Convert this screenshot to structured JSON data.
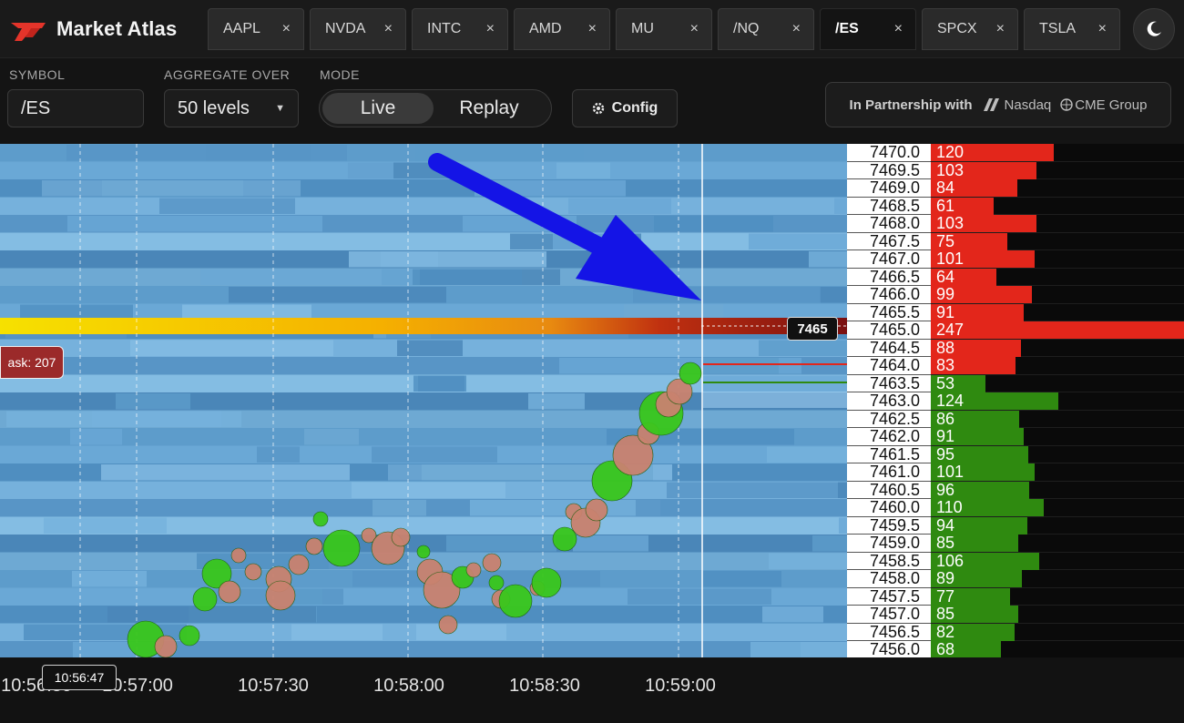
{
  "app": {
    "name": "Market Atlas"
  },
  "tabs": [
    {
      "label": "AAPL",
      "active": false
    },
    {
      "label": "NVDA",
      "active": false
    },
    {
      "label": "INTC",
      "active": false
    },
    {
      "label": "AMD",
      "active": false
    },
    {
      "label": "MU",
      "active": false
    },
    {
      "label": "/NQ",
      "active": false
    },
    {
      "label": "/ES",
      "active": true
    },
    {
      "label": "SPCX",
      "active": false
    },
    {
      "label": "TSLA",
      "active": false
    }
  ],
  "tab_close_glyph": "×",
  "controls": {
    "symbol_label": "SYMBOL",
    "symbol_value": "/ES",
    "aggregate_label": "AGGREGATE OVER",
    "aggregate_value": "50 levels",
    "mode_label": "MODE",
    "mode_options": [
      "Live",
      "Replay"
    ],
    "mode_selected": "Live",
    "config_label": "Config",
    "partner_prefix": "In Partnership with",
    "partner_nasdaq": "Nasdaq",
    "partner_cme": "CME Group"
  },
  "icons": {
    "theme": "moon-icon",
    "config": "gear-icon",
    "logo": "market-atlas-logo"
  },
  "colors": {
    "ask": "#e3261b",
    "bid": "#2f8a10",
    "heat_low": "#5f9fcf",
    "heat_high": "#fff200",
    "annotation_arrow": "#1414e6"
  },
  "chart": {
    "price_marker": "7465",
    "ask_label": "ask: 207",
    "cursor_time": "10:56:47",
    "time_ticks": [
      "10:56:30",
      "10:57:00",
      "10:57:30",
      "10:58:00",
      "10:58:30",
      "10:59:00"
    ]
  },
  "ladder": {
    "max_size": 247,
    "asks": [
      {
        "price": "7470.0",
        "size": 120
      },
      {
        "price": "7469.5",
        "size": 103
      },
      {
        "price": "7469.0",
        "size": 84
      },
      {
        "price": "7468.5",
        "size": 61
      },
      {
        "price": "7468.0",
        "size": 103
      },
      {
        "price": "7467.5",
        "size": 75
      },
      {
        "price": "7467.0",
        "size": 101
      },
      {
        "price": "7466.5",
        "size": 64
      },
      {
        "price": "7466.0",
        "size": 99
      },
      {
        "price": "7465.5",
        "size": 91
      },
      {
        "price": "7465.0",
        "size": 247
      },
      {
        "price": "7464.5",
        "size": 88
      },
      {
        "price": "7464.0",
        "size": 83
      }
    ],
    "bids": [
      {
        "price": "7463.5",
        "size": 53
      },
      {
        "price": "7463.0",
        "size": 124
      },
      {
        "price": "7462.5",
        "size": 86
      },
      {
        "price": "7462.0",
        "size": 91
      },
      {
        "price": "7461.5",
        "size": 95
      },
      {
        "price": "7461.0",
        "size": 101
      },
      {
        "price": "7460.5",
        "size": 96
      },
      {
        "price": "7460.0",
        "size": 110
      },
      {
        "price": "7459.5",
        "size": 94
      },
      {
        "price": "7459.0",
        "size": 85
      },
      {
        "price": "7458.5",
        "size": 106
      },
      {
        "price": "7458.0",
        "size": 89
      },
      {
        "price": "7457.5",
        "size": 77
      },
      {
        "price": "7457.0",
        "size": 85
      },
      {
        "price": "7456.5",
        "size": 82
      },
      {
        "price": "7456.0",
        "size": 68
      }
    ]
  }
}
